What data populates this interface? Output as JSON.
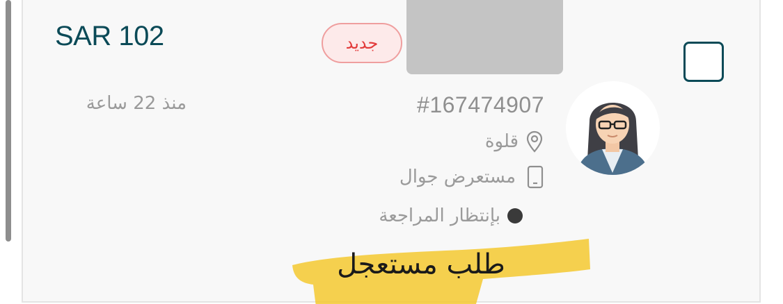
{
  "order": {
    "price": "SAR 102",
    "badge": "جديد",
    "time_ago": "منذ 22 ساعة",
    "order_id": "#167474907",
    "location": "قلوة",
    "device": "مستعرض جوال",
    "status": "بإنتظار المراجعة",
    "urgent_note": "طلب مستعجل"
  },
  "icons": {
    "location": "location-pin-icon",
    "device": "mobile-phone-icon",
    "status": "status-dot-icon",
    "avatar": "user-avatar-icon"
  },
  "colors": {
    "price": "#0b4a57",
    "badge_text": "#e23a3a",
    "badge_border": "#ef9e9e",
    "highlight": "#f5c930",
    "muted_text": "#9a9a9a"
  }
}
